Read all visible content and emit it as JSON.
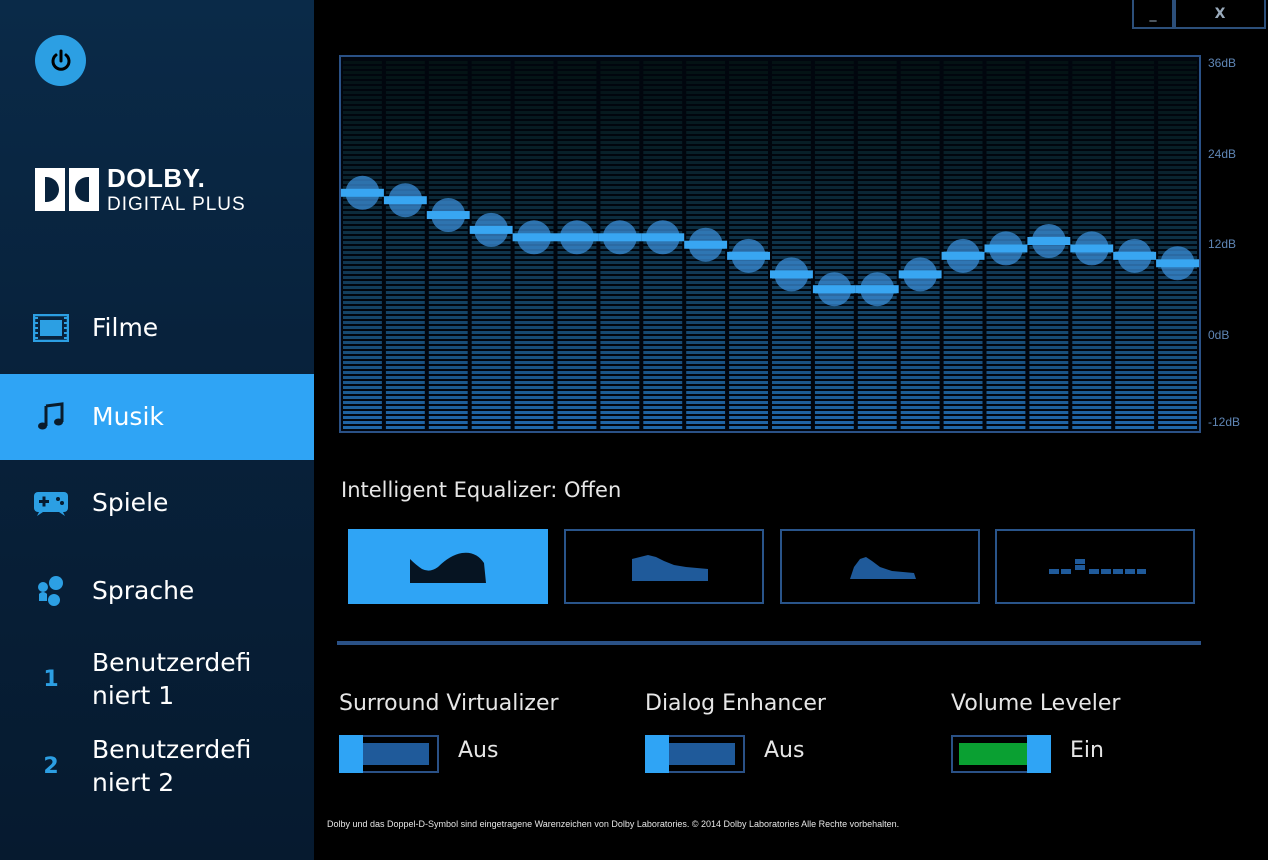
{
  "window": {
    "minimize_label": "_",
    "close_label": "X"
  },
  "colors": {
    "accent": "#2fa4f5",
    "sidebar_bg": "#08223c",
    "eq_border": "#2a5186",
    "toggle_on": "#0aa032"
  },
  "brand": {
    "line1": "DOLBY.",
    "line2": "DIGITAL PLUS"
  },
  "sidebar": {
    "items": [
      {
        "label": "Filme",
        "icon": "film-icon",
        "active": false
      },
      {
        "label": "Musik",
        "icon": "music-note-icon",
        "active": true
      },
      {
        "label": "Spiele",
        "icon": "gamepad-icon",
        "active": false
      },
      {
        "label": "Sprache",
        "icon": "speech-bubbles-icon",
        "active": false
      },
      {
        "label_line1": "Benutzerdefi",
        "label_line2": "niert 1",
        "icon": "number-1-icon",
        "icon_text": "1",
        "active": false
      },
      {
        "label_line1": "Benutzerdefi",
        "label_line2": "niert 2",
        "icon": "number-2-icon",
        "icon_text": "2",
        "active": false
      }
    ]
  },
  "equalizer": {
    "db_scale": [
      "36dB",
      "24dB",
      "12dB",
      "0dB",
      "-12dB"
    ],
    "db_min": -12,
    "db_max": 36,
    "band_count": 20,
    "band_levels_db": [
      18.5,
      17.5,
      15.5,
      13.5,
      12.5,
      12.5,
      12.5,
      12.5,
      11.5,
      10,
      7.5,
      5.5,
      5.5,
      7.5,
      10,
      11,
      12,
      11,
      10,
      9
    ]
  },
  "intelligent_eq": {
    "title": "Intelligent Equalizer: Offen",
    "presets": [
      {
        "name": "open-preset",
        "active": true
      },
      {
        "name": "rich-preset",
        "active": false
      },
      {
        "name": "focused-preset",
        "active": false
      },
      {
        "name": "custom-preset",
        "active": false
      }
    ]
  },
  "features": [
    {
      "title": "Surround Virtualizer",
      "state": "Aus",
      "on": false
    },
    {
      "title": "Dialog Enhancer",
      "state": "Aus",
      "on": false
    },
    {
      "title": "Volume Leveler",
      "state": "Ein",
      "on": true
    }
  ],
  "footer": {
    "text": "Dolby und das Doppel-D-Symbol sind eingetragene Warenzeichen von Dolby Laboratories. © 2014 Dolby Laboratories Alle Rechte vorbehalten."
  }
}
